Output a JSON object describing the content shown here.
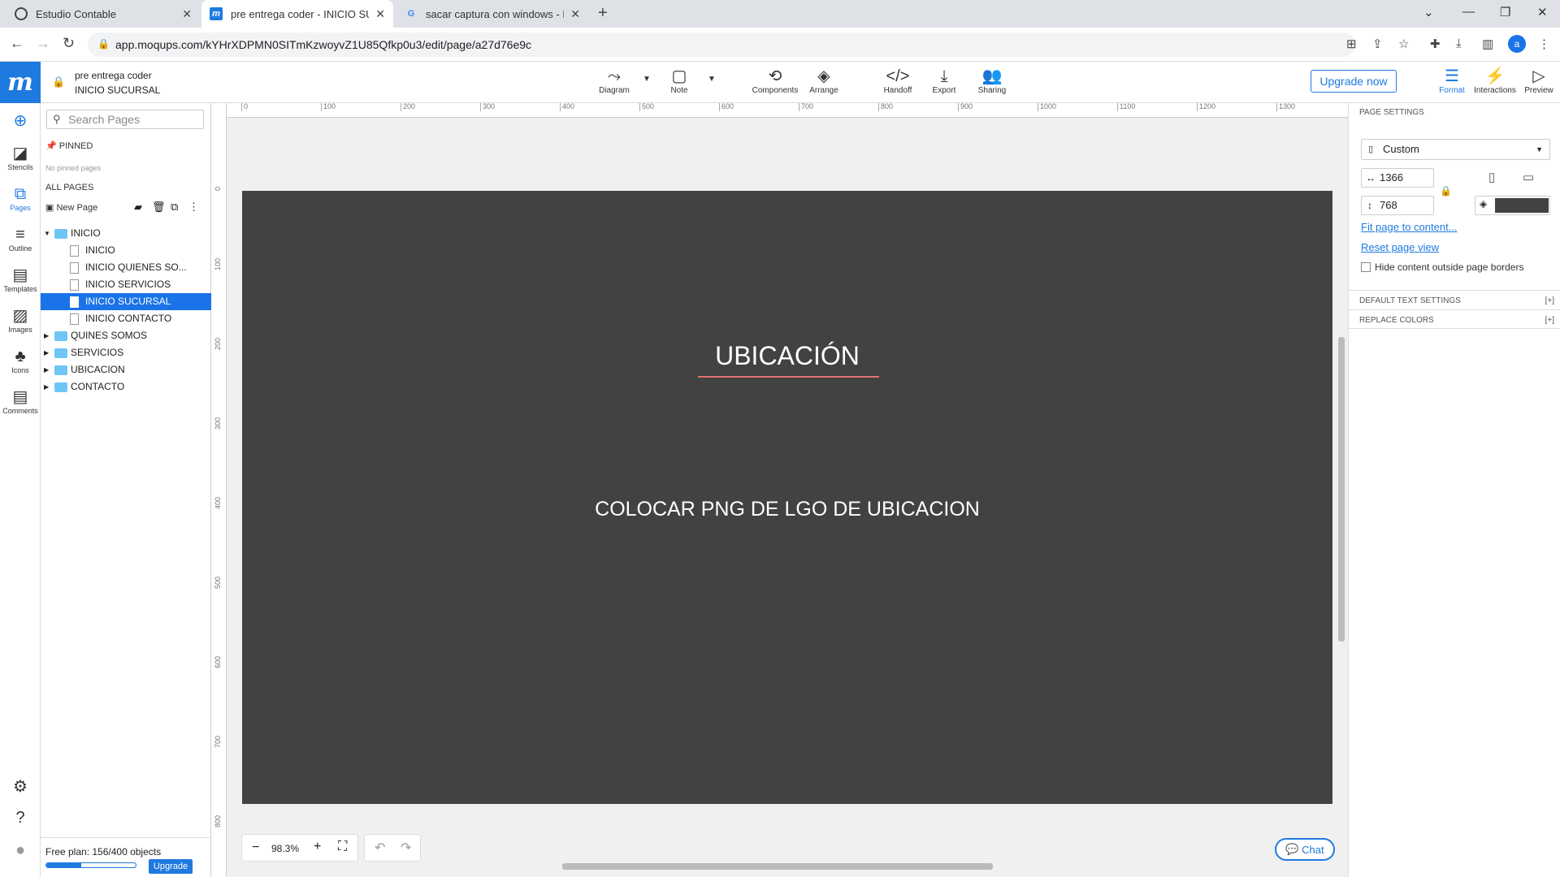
{
  "browser": {
    "tabs": [
      {
        "title": "Estudio Contable",
        "active": false
      },
      {
        "title": "pre entrega coder - INICIO SUCU",
        "active": true
      },
      {
        "title": "sacar captura con windows - Bus",
        "active": false
      }
    ],
    "url": "app.moqups.com/kYHrXDPMN0SITmKzwoyvZ1U85Qfkp0u3/edit/page/a27d76e9c",
    "avatar_letter": "a"
  },
  "header": {
    "logo": "m",
    "project_name": "pre entrega coder",
    "page_name": "INICIO SUCURSAL",
    "tools": [
      "Diagram",
      "Note",
      "Components",
      "Arrange",
      "Handoff",
      "Export",
      "Sharing"
    ],
    "upgrade_label": "Upgrade now",
    "right_tools": [
      "Format",
      "Interactions",
      "Preview"
    ]
  },
  "rail": [
    "Stencils",
    "Pages",
    "Outline",
    "Templates",
    "Images",
    "Icons",
    "Comments"
  ],
  "pages_panel": {
    "search_placeholder": "Search Pages",
    "pinned_label": "PINNED",
    "no_pinned": "No pinned pages",
    "all_pages_label": "ALL PAGES",
    "new_page_label": "New Page",
    "tree": [
      {
        "label": "INICIO",
        "type": "folder",
        "expanded": true
      },
      {
        "label": "INICIO",
        "type": "page"
      },
      {
        "label": "INICIO QUIENES SO...",
        "type": "page"
      },
      {
        "label": "INICIO SERVICIOS",
        "type": "page"
      },
      {
        "label": "INICIO SUCURSAL",
        "type": "page",
        "selected": true
      },
      {
        "label": "INICIO CONTACTO",
        "type": "page"
      },
      {
        "label": "QUINES SOMOS",
        "type": "folder"
      },
      {
        "label": "SERVICIOS",
        "type": "folder"
      },
      {
        "label": "UBICACION",
        "type": "folder"
      },
      {
        "label": "CONTACTO",
        "type": "folder"
      }
    ],
    "plan_text": "Free plan: 156/400 objects",
    "plan_progress": 0.39,
    "plan_upgrade": "Upgrade"
  },
  "canvas": {
    "ruler_h": [
      "0",
      "100",
      "200",
      "300",
      "400",
      "500",
      "600",
      "700",
      "800",
      "900",
      "1000",
      "1100",
      "1200",
      "1300"
    ],
    "ruler_v": [
      "0",
      "100",
      "200",
      "300",
      "400",
      "500",
      "600",
      "700",
      "800"
    ],
    "heading": "UBICACIÓN",
    "body": "COLOCAR PNG DE LGO DE UBICACION",
    "page_color": "#424242",
    "accent_underline": "#e07070",
    "zoom": "98.3%",
    "chat_label": "Chat"
  },
  "page_settings": {
    "title": "PAGE SETTINGS",
    "preset": "Custom",
    "width": "1366",
    "height": "768",
    "fit_link": "Fit page to content...",
    "reset_link": "Reset page view",
    "hide_label": "Hide content outside page borders",
    "default_text": "DEFAULT TEXT SETTINGS",
    "replace_colors": "REPLACE COLORS",
    "expand_symbol": "[+]",
    "bg_color": "#424242"
  }
}
